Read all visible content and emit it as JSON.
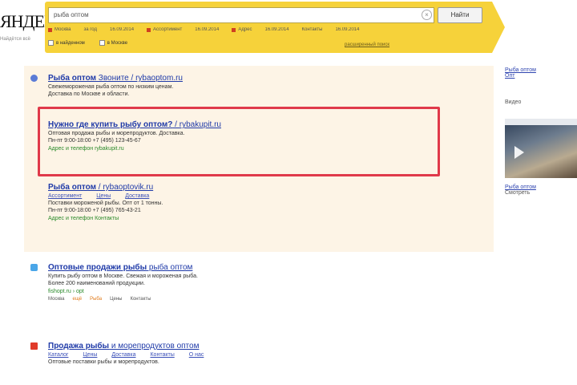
{
  "header": {
    "logo": "ЯНДЕКС",
    "logo_sub": "Найдётся всё",
    "search_value": "рыба оптом",
    "clear_glyph": "×",
    "find_button": "Найти",
    "filters": [
      {
        "label": "Москва",
        "marker": true
      },
      {
        "label": "за год",
        "marker": false
      },
      {
        "label": "16.09.2014",
        "marker": false
      },
      {
        "label": "Ассортимент",
        "marker": true
      },
      {
        "label": "16.09.2014",
        "marker": false
      },
      {
        "label": "Адрес",
        "marker": true
      },
      {
        "label": "16.09.2014",
        "marker": false
      },
      {
        "label": "Контакты",
        "marker": false
      },
      {
        "label": "16.09.2014",
        "marker": false
      }
    ],
    "checkboxes": [
      "в найденном",
      "в Москве"
    ],
    "area_link": "расширенный поиск"
  },
  "ads": [
    {
      "title": "Рыба оптом",
      "title_tail": " Звоните / rybaoptom.ru",
      "lines": [
        "Свежемороженая рыба оптом по низким ценам.",
        "Доставка по Москве и области."
      ],
      "green": "",
      "links": []
    },
    {
      "title": "Нужно где купить рыбу оптом?",
      "title_tail": " / rybakupit.ru",
      "lines": [
        "Оптовая продажа рыбы и морепродуктов. Доставка.",
        "Пн-пт 9:00-18:00    +7 (495) 123-45-67"
      ],
      "green": "Адрес и телефон    rybakupit.ru",
      "links": []
    },
    {
      "title": "Рыба оптом",
      "title_tail": " / rybaoptovik.ru",
      "lines": [
        "Поставки мороженой рыбы. Опт от 1 тонны.",
        "Пн-пт 9:00-18:00    +7 (495) 765-43-21"
      ],
      "green": "Адрес и телефон    Контакты",
      "links": [
        "Ассортимент",
        "Цены",
        "Доставка"
      ]
    }
  ],
  "organic": [
    {
      "title": "Оптовые продажи рыбы",
      "title_tail": " рыба оптом",
      "lines": [
        "Купить рыбу оптом в Москве. Свежая и мороженая рыба.",
        "Более 200 наименований продукции."
      ],
      "green": "fishopt.ru › opt",
      "meta": [
        {
          "text": "Москва",
          "orange": false
        },
        {
          "text": "ещё",
          "orange": true
        },
        {
          "text": "Рыба",
          "orange": true
        },
        {
          "text": "Цены",
          "orange": false
        },
        {
          "text": "Контакты",
          "orange": false
        }
      ]
    },
    {
      "title": "Продажа рыбы",
      "title_tail": " и морепродуктов оптом",
      "lines": [
        "Оптовые поставки рыбы и морепродуктов."
      ],
      "green": "",
      "links": [
        "Каталог",
        "Цены",
        "Доставка",
        "Контакты",
        "О нас"
      ]
    }
  ],
  "right": {
    "links": [
      "Рыба оптом",
      "Опт"
    ],
    "video_heading": "Видео",
    "video_caption": "Рыба оптом",
    "video_sub": "Смотреть"
  },
  "colors": {
    "brand_yellow": "#f6d23a",
    "link": "#1f3aa8",
    "green": "#2a8a2a",
    "highlight": "#e0394a"
  }
}
